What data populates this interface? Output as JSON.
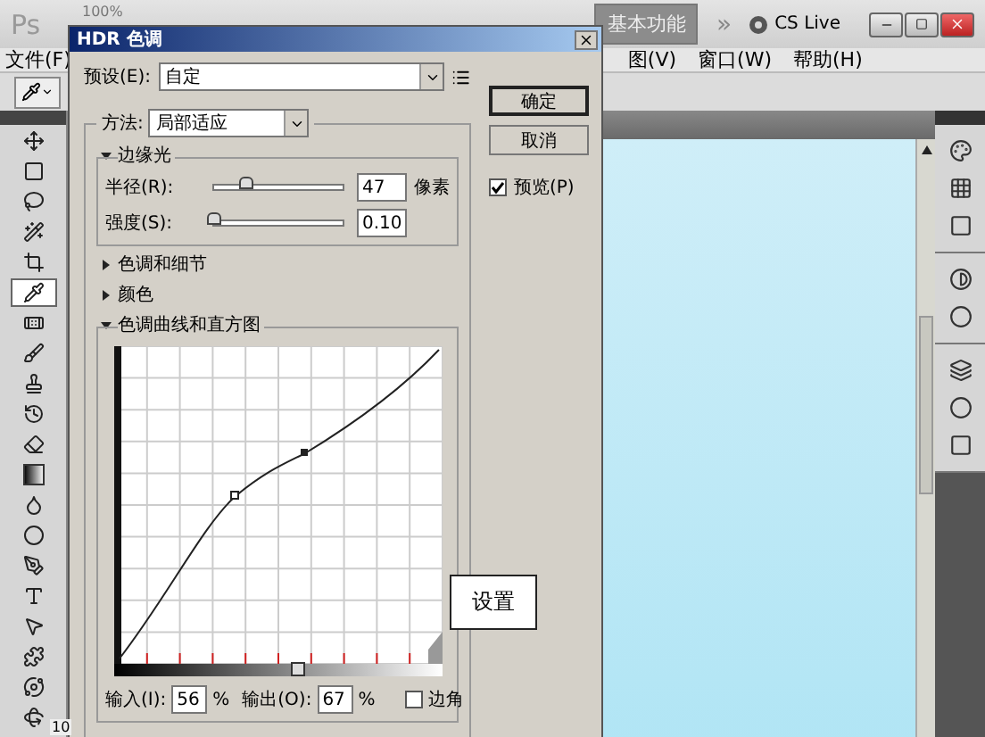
{
  "app": {
    "logo": "Ps",
    "zoom": "100%",
    "workspace": "基本功能",
    "more": "»",
    "cs_live": "CS Live"
  },
  "menu": [
    "文件(F)",
    "图(V)",
    "窗口(W)",
    "帮助(H)"
  ],
  "tools": [
    {
      "kind": "move",
      "selected": false
    },
    {
      "kind": "marquee",
      "selected": false
    },
    {
      "kind": "lasso",
      "selected": false
    },
    {
      "kind": "wand",
      "selected": false
    },
    {
      "kind": "crop",
      "selected": false
    },
    {
      "kind": "pipette",
      "selected": true
    },
    {
      "kind": "bandage",
      "selected": false
    },
    {
      "kind": "brush",
      "selected": false
    },
    {
      "kind": "stamp",
      "selected": false
    },
    {
      "kind": "history",
      "selected": false
    },
    {
      "kind": "eraser",
      "selected": false
    },
    {
      "kind": "gradient",
      "selected": false
    },
    {
      "kind": "droplet",
      "selected": false
    },
    {
      "kind": "dodge",
      "selected": false
    },
    {
      "kind": "pen",
      "selected": false
    },
    {
      "kind": "type",
      "selected": false
    },
    {
      "kind": "pointer",
      "selected": false
    },
    {
      "kind": "shape",
      "selected": false
    },
    {
      "kind": "orbit",
      "selected": false
    },
    {
      "kind": "rotate",
      "selected": false
    }
  ],
  "status_zoom": "10",
  "dialog": {
    "title": "HDR 色调",
    "preset_label": "预设(E):",
    "preset_value": "自定",
    "buttons": [
      {
        "label": "确定",
        "default": true
      },
      {
        "label": "取消",
        "default": false
      }
    ],
    "preview": {
      "label": "预览(P)",
      "checked": true
    },
    "method": {
      "label": "方法:",
      "value": "局部适应"
    },
    "sections": [
      {
        "kind": "sliders",
        "title": "边缘光",
        "expanded": true,
        "controls": [
          {
            "label": "半径(R):",
            "value": "47",
            "unit": "像素",
            "level": 0.25
          },
          {
            "label": "强度(S):",
            "value": "0.10",
            "level": 0.0
          }
        ]
      },
      {
        "title": "色调和细节",
        "expanded": false
      },
      {
        "title": "颜色",
        "expanded": false
      },
      {
        "kind": "curve",
        "title": "色调曲线和直方图",
        "expanded": true,
        "input": {
          "label": "输入(I):",
          "value": "56",
          "unit": "%"
        },
        "output": {
          "label": "输出(O):",
          "value": "67",
          "unit": "%"
        },
        "corner": {
          "label": "边角",
          "checked": false
        }
      }
    ]
  },
  "annotation": "设置"
}
